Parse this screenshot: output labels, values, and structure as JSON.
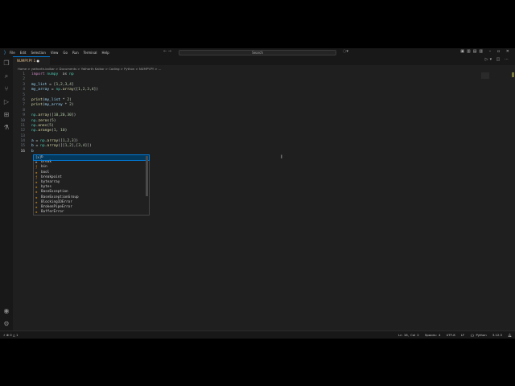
{
  "menu": [
    "File",
    "Edit",
    "Selection",
    "View",
    "Go",
    "Run",
    "Terminal",
    "Help"
  ],
  "search_placeholder": "Search",
  "tab": {
    "label": "NUMPY.PY 1",
    "dirty": "●"
  },
  "breadcrumb": "Home > yatharth-kalkar > Documents > Yatharth Kalkar > Coding > Python > NUMPY.PY > ...",
  "code": [
    [
      "1",
      [
        [
          "kw",
          "import "
        ],
        [
          "md",
          "numpy"
        ],
        [
          "",
          "  as "
        ],
        [
          "md",
          "np"
        ]
      ]
    ],
    [
      "2",
      []
    ],
    [
      "3",
      [
        [
          "id",
          "my_list"
        ],
        [
          "",
          " = ["
        ],
        [
          "num",
          "1"
        ],
        [
          "",
          ","
        ],
        [
          "num",
          "2"
        ],
        [
          "",
          ","
        ],
        [
          "num",
          "3"
        ],
        [
          "",
          ","
        ],
        [
          "num",
          "4"
        ],
        [
          "",
          "]"
        ]
      ]
    ],
    [
      "4",
      [
        [
          "id",
          "my_array"
        ],
        [
          "",
          " = "
        ],
        [
          "md",
          "np"
        ],
        [
          "",
          "."
        ],
        [
          "fn",
          "array"
        ],
        [
          "",
          "(["
        ],
        [
          "num",
          "1,2,3,4"
        ],
        [
          "",
          "])"
        ]
      ]
    ],
    [
      "5",
      []
    ],
    [
      "6",
      [
        [
          "fn",
          "print"
        ],
        [
          "",
          "("
        ],
        [
          "id",
          "my_list"
        ],
        [
          "",
          " * "
        ],
        [
          "num",
          "2"
        ],
        [
          "",
          ")"
        ]
      ]
    ],
    [
      "7",
      [
        [
          "fn",
          "print"
        ],
        [
          "",
          "("
        ],
        [
          "id",
          "my_array"
        ],
        [
          "",
          " * "
        ],
        [
          "num",
          "2"
        ],
        [
          "",
          ")"
        ]
      ]
    ],
    [
      "8",
      []
    ],
    [
      "9",
      [
        [
          "md",
          "np"
        ],
        [
          "",
          "."
        ],
        [
          "fn",
          "array"
        ],
        [
          "",
          "(["
        ],
        [
          "num",
          "10,20,30"
        ],
        [
          "",
          "])"
        ]
      ]
    ],
    [
      "10",
      [
        [
          "md",
          "np"
        ],
        [
          "",
          "."
        ],
        [
          "fn",
          "zeros"
        ],
        [
          "",
          "("
        ],
        [
          "num",
          "5"
        ],
        [
          "",
          ")"
        ]
      ]
    ],
    [
      "11",
      [
        [
          "md",
          "np"
        ],
        [
          "",
          "."
        ],
        [
          "fn",
          "ones"
        ],
        [
          "",
          "("
        ],
        [
          "num",
          "5"
        ],
        [
          "",
          ")"
        ]
      ]
    ],
    [
      "12",
      [
        [
          "md",
          "np"
        ],
        [
          "",
          "."
        ],
        [
          "fn",
          "arange"
        ],
        [
          "",
          "("
        ],
        [
          "num",
          "1"
        ],
        [
          "",
          ", "
        ],
        [
          "num",
          "10"
        ],
        [
          "",
          ")"
        ]
      ]
    ],
    [
      "13",
      []
    ],
    [
      "14",
      [
        [
          "id",
          "a"
        ],
        [
          "",
          " = "
        ],
        [
          "md",
          "np"
        ],
        [
          "",
          "."
        ],
        [
          "fn",
          "array"
        ],
        [
          "",
          "(["
        ],
        [
          "num",
          "1,2,3"
        ],
        [
          "",
          "])"
        ]
      ]
    ],
    [
      "15",
      [
        [
          "id",
          "b"
        ],
        [
          "",
          " = "
        ],
        [
          "md",
          "np"
        ],
        [
          "",
          "."
        ],
        [
          "fn",
          "array"
        ],
        [
          "",
          "([["
        ],
        [
          "num",
          "1,2"
        ],
        [
          "",
          "],["
        ],
        [
          "num",
          "3,4"
        ],
        [
          "",
          "]])"
        ]
      ]
    ],
    [
      "16",
      [
        [
          "id",
          "b"
        ]
      ]
    ]
  ],
  "suggestions": [
    {
      "icon": "variable",
      "label": "b"
    },
    {
      "icon": "keyword",
      "label": "break"
    },
    {
      "icon": "function",
      "label": "bin"
    },
    {
      "icon": "class",
      "label": "bool"
    },
    {
      "icon": "function",
      "label": "breakpoint"
    },
    {
      "icon": "class",
      "label": "bytearray"
    },
    {
      "icon": "class",
      "label": "bytes"
    },
    {
      "icon": "class",
      "label": "BaseException"
    },
    {
      "icon": "class",
      "label": "BaseExceptionGroup"
    },
    {
      "icon": "class",
      "label": "BlockingIOError"
    },
    {
      "icon": "class",
      "label": "BrokenPipeError"
    },
    {
      "icon": "class",
      "label": "BufferError"
    }
  ],
  "status": {
    "problems": "⊗ 0 △ 1",
    "position": "Ln 16, Col 2",
    "indent": "Spaces: 4",
    "encoding": "UTF-8",
    "eol": "LF",
    "language": "{} Python",
    "version": "3.12.3"
  },
  "badge": "1"
}
